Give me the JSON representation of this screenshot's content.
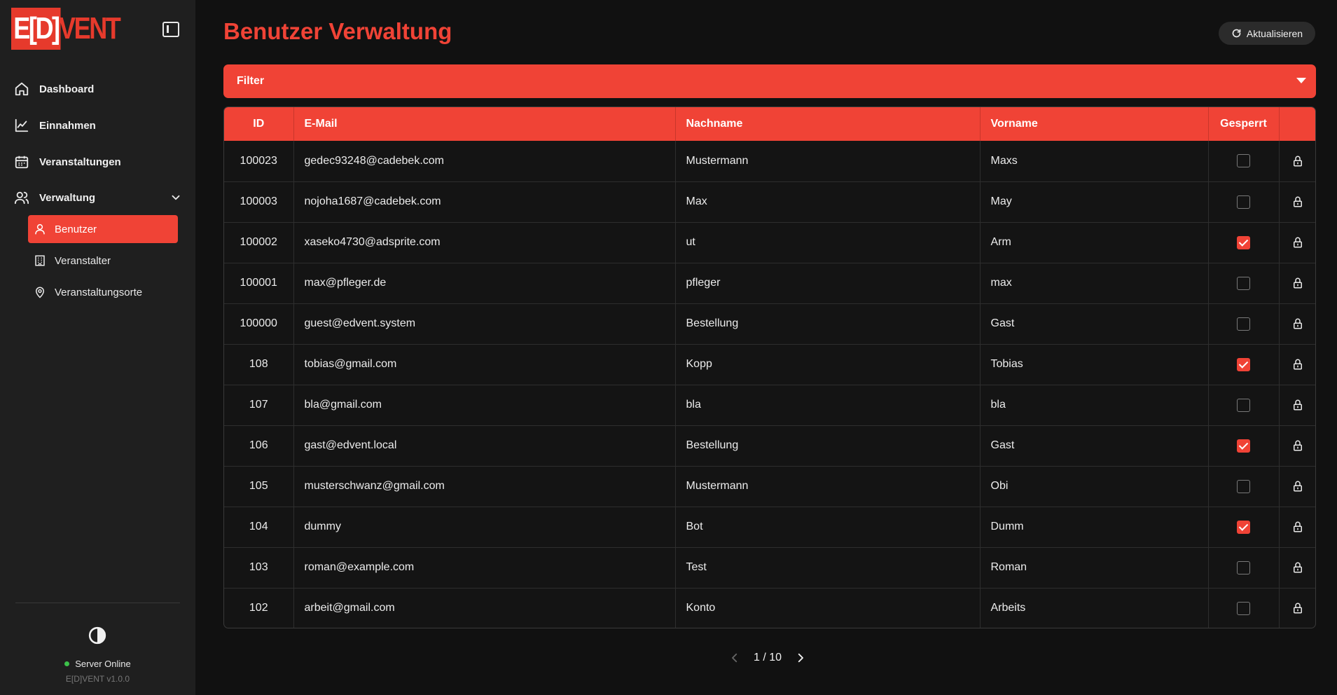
{
  "brand": {
    "logo_box": "E[D]",
    "logo_rest": "VENT",
    "accent": "#f04336"
  },
  "sidebar": {
    "items": [
      {
        "label": "Dashboard",
        "icon": "home-icon"
      },
      {
        "label": "Einnahmen",
        "icon": "chart-line-icon"
      },
      {
        "label": "Veranstaltungen",
        "icon": "calendar-icon"
      },
      {
        "label": "Verwaltung",
        "icon": "users-icon",
        "expanded": true
      }
    ],
    "sub_items": [
      {
        "label": "Benutzer",
        "icon": "user-icon",
        "active": true
      },
      {
        "label": "Veranstalter",
        "icon": "building-icon",
        "active": false
      },
      {
        "label": "Veranstaltungsorte",
        "icon": "map-pin-icon",
        "active": false
      }
    ],
    "server_status": "Server Online",
    "version": "E[D]VENT v1.0.0"
  },
  "header": {
    "title": "Benutzer Verwaltung",
    "refresh_label": "Aktualisieren"
  },
  "filter": {
    "label": "Filter"
  },
  "table": {
    "columns": [
      "ID",
      "E-Mail",
      "Nachname",
      "Vorname",
      "Gesperrt",
      ""
    ],
    "rows": [
      {
        "id": "100023",
        "email": "gedec93248@cadebek.com",
        "nachname": "Mustermann",
        "vorname": "Maxs",
        "gesperrt": false
      },
      {
        "id": "100003",
        "email": "nojoha1687@cadebek.com",
        "nachname": "Max",
        "vorname": "May",
        "gesperrt": false
      },
      {
        "id": "100002",
        "email": "xaseko4730@adsprite.com",
        "nachname": "ut",
        "vorname": "Arm",
        "gesperrt": true
      },
      {
        "id": "100001",
        "email": "max@pfleger.de",
        "nachname": "pfleger",
        "vorname": "max",
        "gesperrt": false
      },
      {
        "id": "100000",
        "email": "guest@edvent.system",
        "nachname": "Bestellung",
        "vorname": "Gast",
        "gesperrt": false
      },
      {
        "id": "108",
        "email": "tobias@gmail.com",
        "nachname": "Kopp",
        "vorname": "Tobias",
        "gesperrt": true
      },
      {
        "id": "107",
        "email": "bla@gmail.com",
        "nachname": "bla",
        "vorname": "bla",
        "gesperrt": false
      },
      {
        "id": "106",
        "email": "gast@edvent.local",
        "nachname": "Bestellung",
        "vorname": "Gast",
        "gesperrt": true
      },
      {
        "id": "105",
        "email": "musterschwanz@gmail.com",
        "nachname": "Mustermann",
        "vorname": "Obi",
        "gesperrt": false
      },
      {
        "id": "104",
        "email": "dummy",
        "nachname": "Bot",
        "vorname": "Dumm",
        "gesperrt": true
      },
      {
        "id": "103",
        "email": "roman@example.com",
        "nachname": "Test",
        "vorname": "Roman",
        "gesperrt": false
      },
      {
        "id": "102",
        "email": "arbeit@gmail.com",
        "nachname": "Konto",
        "vorname": "Arbeits",
        "gesperrt": false
      }
    ]
  },
  "pagination": {
    "label": "1 / 10"
  }
}
